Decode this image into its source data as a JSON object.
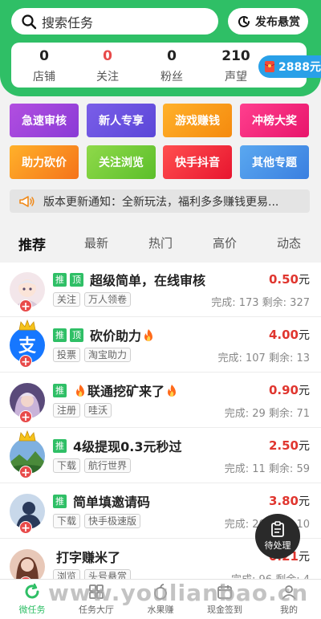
{
  "header": {
    "search_placeholder": "搜索任务",
    "publish_label": "发布悬赏",
    "stats": [
      {
        "value": "0",
        "label": "店铺",
        "highlight": false
      },
      {
        "value": "0",
        "label": "关注",
        "highlight": true
      },
      {
        "value": "0",
        "label": "粉丝",
        "highlight": false
      },
      {
        "value": "210",
        "label": "声望",
        "highlight": false
      }
    ],
    "coin_value": "2888元"
  },
  "categories": [
    {
      "label": "急速审核",
      "gradient": [
        "#b24ee0",
        "#8a3bd6"
      ]
    },
    {
      "label": "新人专享",
      "gradient": [
        "#7a5ee8",
        "#5b47d8"
      ]
    },
    {
      "label": "游戏赚钱",
      "gradient": [
        "#ffb12a",
        "#f58a0e"
      ]
    },
    {
      "label": "冲榜大奖",
      "gradient": [
        "#ff3f8e",
        "#e8156b"
      ]
    },
    {
      "label": "助力砍价",
      "gradient": [
        "#ffb12a",
        "#f5731a"
      ]
    },
    {
      "label": "关注浏览",
      "gradient": [
        "#8fd94a",
        "#5cbf2a"
      ]
    },
    {
      "label": "快手抖音",
      "gradient": [
        "#ff4f4f",
        "#e8152f"
      ]
    },
    {
      "label": "其他专题",
      "gradient": [
        "#5aa8f0",
        "#3a7fe0"
      ]
    }
  ],
  "notice": {
    "text": "版本更新通知：全新玩法，福利多多赚钱更易..."
  },
  "tabs": [
    "推荐",
    "最新",
    "热门",
    "高价",
    "动态"
  ],
  "tasks": [
    {
      "badges": [
        "推",
        "顶"
      ],
      "title": "超级简单，在线审核",
      "fire_before": false,
      "fire_after": false,
      "price": "0.50",
      "unit": "元",
      "tags": [
        "关注",
        "万人领卷"
      ],
      "progress": "完成: 173 剩余: 327",
      "avatar": "anime",
      "crown": false
    },
    {
      "badges": [
        "推",
        "顶"
      ],
      "title": "砍价助力",
      "fire_before": false,
      "fire_after": true,
      "price": "4.00",
      "unit": "元",
      "tags": [
        "投票",
        "淘宝助力"
      ],
      "progress": "完成: 107 剩余: 13",
      "avatar": "alipay",
      "crown": true
    },
    {
      "badges": [
        "推"
      ],
      "title": "联通挖矿来了",
      "fire_before": true,
      "fire_after": true,
      "price": "0.90",
      "unit": "元",
      "tags": [
        "注册",
        "哇沃"
      ],
      "progress": "完成: 29 剩余: 71",
      "avatar": "girl",
      "crown": false
    },
    {
      "badges": [
        "推"
      ],
      "title": "4级提现0.3元秒过",
      "fire_before": false,
      "fire_after": false,
      "price": "2.50",
      "unit": "元",
      "tags": [
        "下载",
        "航行世界"
      ],
      "progress": "完成: 11 剩余: 59",
      "avatar": "landscape",
      "crown": true
    },
    {
      "badges": [
        "推"
      ],
      "title": "简单填邀请码",
      "fire_before": false,
      "fire_after": false,
      "price": "3.80",
      "unit": "元",
      "tags": [
        "下载",
        "快手极速版"
      ],
      "progress": "完成: 20 剩余: 10",
      "avatar": "silhouette",
      "crown": false
    },
    {
      "badges": [],
      "title": "打字赚米了",
      "fire_before": false,
      "fire_after": false,
      "price": "0.21",
      "unit": "元",
      "tags": [
        "浏览",
        "头号悬赏"
      ],
      "progress": "完成: 96 剩余: 4",
      "avatar": "woman",
      "crown": false
    }
  ],
  "pending_label": "待处理",
  "bottom_nav": [
    {
      "label": "微任务",
      "icon": "refresh-icon",
      "active": true
    },
    {
      "label": "任务大厅",
      "icon": "grid-icon",
      "active": false
    },
    {
      "label": "水果赚",
      "icon": "fruit-icon",
      "active": false
    },
    {
      "label": "现金签到",
      "icon": "calendar-icon",
      "active": false
    },
    {
      "label": "我的",
      "icon": "user-icon",
      "active": false
    }
  ],
  "watermark": "www.youlianbao.cn",
  "colors": {
    "brand_green": "#2fbf66",
    "price_red": "#e0362f",
    "coin_blue": "#29a0e8"
  }
}
